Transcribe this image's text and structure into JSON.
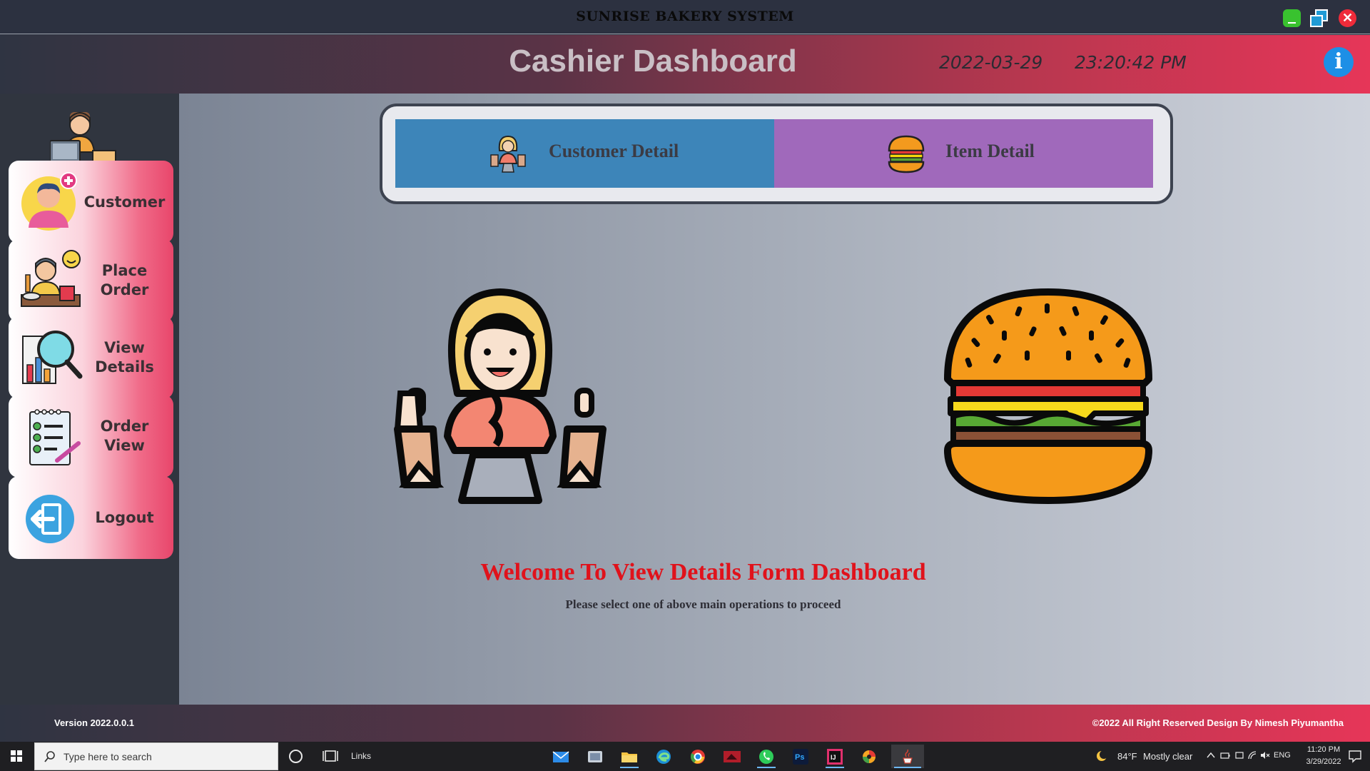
{
  "window": {
    "title": "SUNRISE BAKERY SYSTEM",
    "controls": [
      "minimize",
      "maximize",
      "close"
    ],
    "close_glyph": "✕"
  },
  "header": {
    "title": "Cashier Dashboard",
    "date": "2022-03-29",
    "time": "23:20:42 PM",
    "info_glyph": "i",
    "colors": {
      "gradient_start": "#2f3442",
      "gradient_end": "#e63658"
    }
  },
  "sidebar": {
    "avatar_icon": "cashier-icon",
    "items": [
      {
        "label_lines": [
          "Customer"
        ],
        "icon": "customer-add-icon"
      },
      {
        "label_lines": [
          "Place",
          "Order"
        ],
        "icon": "place-order-icon"
      },
      {
        "label_lines": [
          "View",
          "Details"
        ],
        "icon": "view-details-icon"
      },
      {
        "label_lines": [
          "Order",
          "View"
        ],
        "icon": "order-view-icon"
      },
      {
        "label_lines": [
          "Logout"
        ],
        "icon": "logout-icon"
      }
    ]
  },
  "tabs": [
    {
      "label": "Customer Detail",
      "icon": "shopper-icon",
      "color": "#3d85b9"
    },
    {
      "label": "Item Detail",
      "icon": "burger-icon",
      "color": "#a069bb"
    }
  ],
  "main": {
    "illustrations": [
      "shopper-icon",
      "burger-icon"
    ],
    "welcome": "Welcome To  View Details Form Dashboard",
    "subtitle": "Please select one of above main operations to proceed",
    "welcome_color": "#e0121b"
  },
  "footer": {
    "version": "Version 2022.0.0.1",
    "copyright": "©2022  All Right Reserved Design By Nimesh Piyumantha"
  },
  "taskbar": {
    "search_placeholder": "Type here to search",
    "links_label": "Links",
    "apps": [
      "mail-icon",
      "photos-icon",
      "file-explorer-icon",
      "edge-icon",
      "chrome-icon",
      "video-app-icon",
      "whatsapp-icon",
      "photoshop-icon",
      "intellij-icon",
      "pinwheel-app-icon",
      "java-app-icon"
    ],
    "photoshop_text": "Ps",
    "intellij_text": "IJ",
    "weather": {
      "temp": "84°F",
      "condition": "Mostly clear"
    },
    "language": "ENG",
    "clock_time": "11:20 PM",
    "clock_date": "3/29/2022"
  }
}
